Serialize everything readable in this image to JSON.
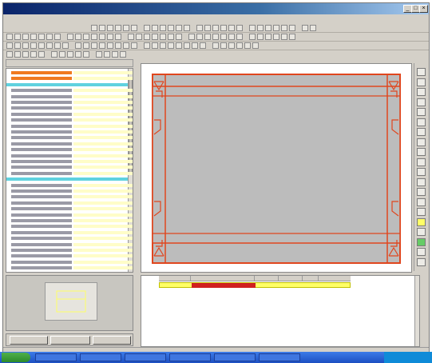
{
  "window": {
    "title": "",
    "controls": [
      "_",
      "□",
      "×"
    ]
  },
  "menu": {
    "items": []
  },
  "colors": {
    "window_bg": "#d4d0c8",
    "titlebar": "#0a246a",
    "drawing_outline": "#e0461e",
    "drawing_fill": "#bcbcbc",
    "property_value_bg": "#fffdc8",
    "property_label_bg": "#9a9aa6",
    "highlight_orange": "#f07a20",
    "highlight_cyan": "#5fd2df",
    "selected_row": "#ffff66"
  },
  "properties_panel": {
    "header": "",
    "rows": [
      {
        "kind": "orange"
      },
      {
        "kind": "orange"
      },
      {
        "kind": "cyan"
      },
      {
        "kind": "normal"
      },
      {
        "kind": "normal"
      },
      {
        "kind": "normal"
      },
      {
        "kind": "normal"
      },
      {
        "kind": "normal"
      },
      {
        "kind": "normal"
      },
      {
        "kind": "normal"
      },
      {
        "kind": "normal"
      },
      {
        "kind": "normal"
      },
      {
        "kind": "normal"
      },
      {
        "kind": "normal"
      },
      {
        "kind": "normal"
      },
      {
        "kind": "normal"
      },
      {
        "kind": "normal"
      },
      {
        "kind": "normal"
      },
      {
        "kind": "cyan"
      },
      {
        "kind": "normal"
      },
      {
        "kind": "normal"
      },
      {
        "kind": "normal"
      },
      {
        "kind": "normal"
      },
      {
        "kind": "normal"
      },
      {
        "kind": "normal"
      },
      {
        "kind": "normal"
      },
      {
        "kind": "normal"
      },
      {
        "kind": "normal"
      },
      {
        "kind": "normal"
      },
      {
        "kind": "normal"
      },
      {
        "kind": "normal"
      },
      {
        "kind": "normal"
      },
      {
        "kind": "normal"
      },
      {
        "kind": "normal"
      }
    ]
  },
  "bottom_tabs": [
    {
      "label": ""
    },
    {
      "label": ""
    },
    {
      "label": ""
    }
  ],
  "grid": {
    "headers": [
      "",
      "",
      "",
      "",
      "",
      ""
    ],
    "rows": [
      {
        "cells": [
          "",
          "",
          "",
          "",
          "",
          ""
        ]
      }
    ]
  },
  "status": {
    "left": "",
    "middle": "",
    "right": ""
  }
}
